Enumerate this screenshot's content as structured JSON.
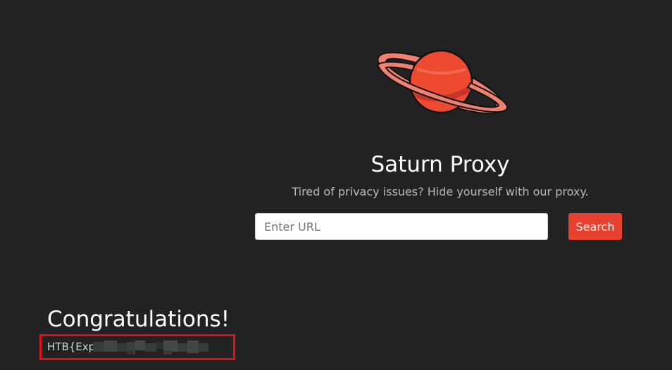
{
  "app": {
    "title": "Saturn Proxy",
    "tagline": "Tired of privacy issues? Hide yourself with our proxy.",
    "logo_icon": "saturn-planet-icon"
  },
  "search": {
    "placeholder": "Enter URL",
    "value": "",
    "button_label": "Search"
  },
  "result": {
    "heading": "Congratulations!",
    "flag_visible_text": "HTB{Exp",
    "flag_redacted": true
  },
  "colors": {
    "background": "#222222",
    "accent": "#e8412f",
    "highlight_box": "#e0101a"
  }
}
